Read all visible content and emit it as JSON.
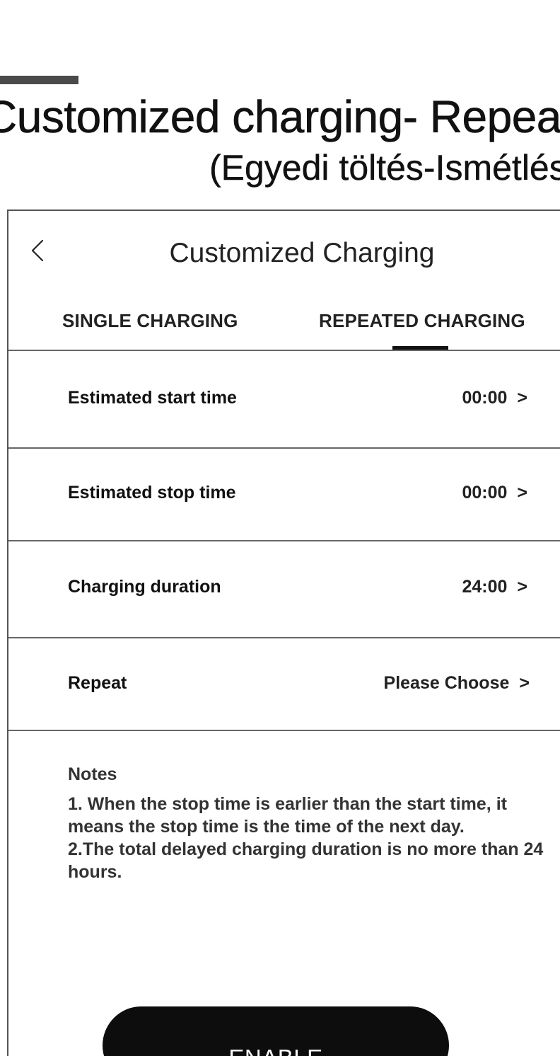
{
  "document": {
    "title": "Customized charging- Repeat",
    "subtitle": "(Egyedi töltés-Ismétlés)"
  },
  "header": {
    "title": "Customized Charging",
    "back_icon": "chevron-left-icon"
  },
  "tabs": [
    {
      "label": "SINGLE CHARGING",
      "active": false
    },
    {
      "label": "REPEATED CHARGING",
      "active": true
    }
  ],
  "settings": [
    {
      "label": "Estimated start time",
      "value": "00:00",
      "chevron": ">"
    },
    {
      "label": "Estimated stop time",
      "value": "00:00",
      "chevron": ">"
    },
    {
      "label": "Charging duration",
      "value": "24:00",
      "chevron": ">"
    },
    {
      "label": "Repeat",
      "value": "Please Choose",
      "chevron": ">"
    }
  ],
  "notes": {
    "title": "Notes",
    "lines": [
      "1. When the stop time is earlier than the start time, it means the stop time is the time of the next day.",
      "2.The total delayed charging duration is no more than 24 hours."
    ]
  },
  "enable_button": {
    "label": "ENABLE"
  },
  "colors": {
    "accent_bar": "#4a4a4a",
    "button_bg": "#0d0d0d",
    "button_text": "#ffffff",
    "divider": "#666666"
  }
}
